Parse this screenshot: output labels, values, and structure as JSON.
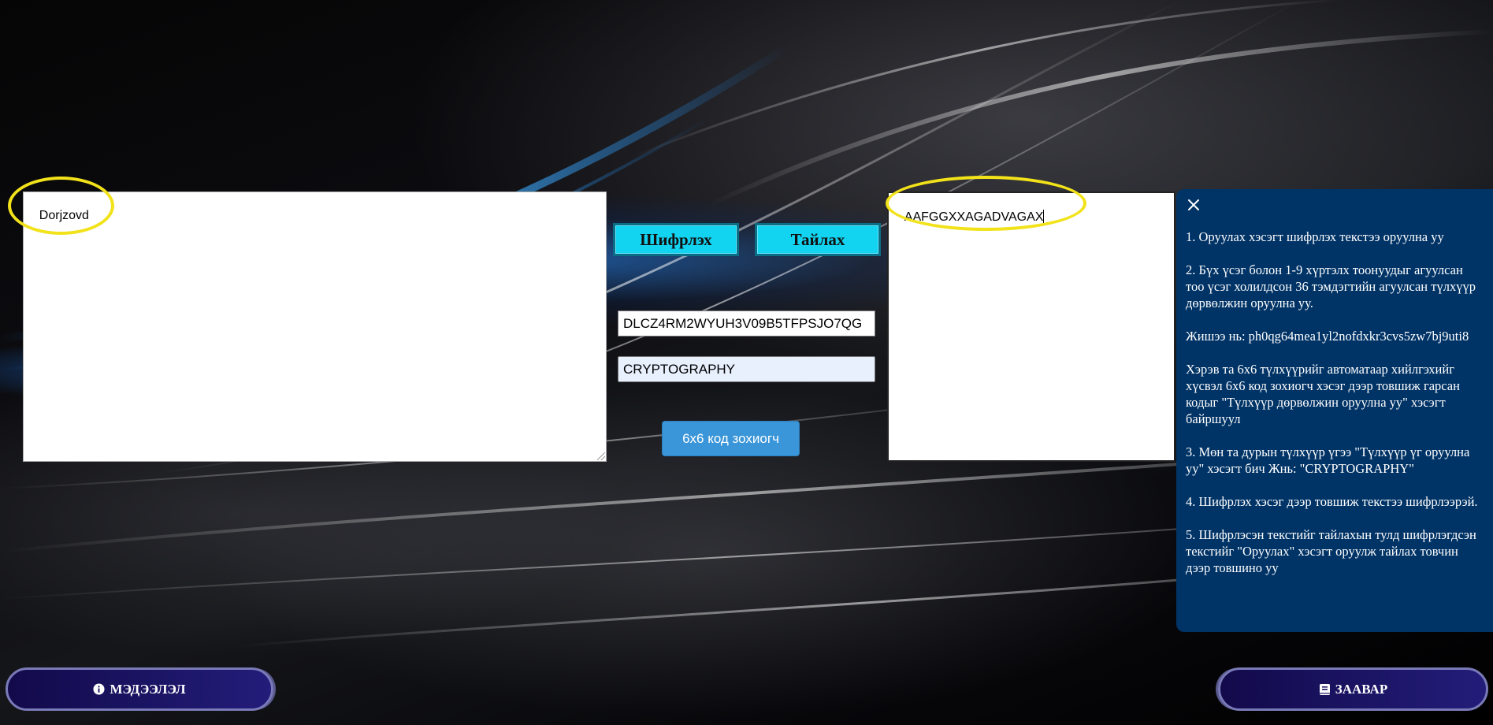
{
  "input": {
    "text": "Dorjzovd"
  },
  "output": {
    "text": "AAFGGXXAGADVAGAX"
  },
  "actions": {
    "encrypt_label": "Шифрлэх",
    "decrypt_label": "Тайлах"
  },
  "fields": {
    "square_key_value": "DLCZ4RM2WYUH3V09B5TFPSJO7QG",
    "keyword_value": "CRYPTOGRAPHY"
  },
  "generator": {
    "label": "6x6 код зохиогч"
  },
  "instructions": {
    "steps": [
      "1. Оруулах хэсэгт шифрлэх текстээ оруулна уу",
      "2. Бүх үсэг болон 1-9 хүртэлх тоонуудыг агуулсан тоо үсэг холилдсон 36 тэмдэгтийн агуулсан түлхүүр дөрвөлжин оруулна уу.",
      "Жишээ нь: ph0qg64mea1yl2nofdxkr3cvs5zw7bj9uti8",
      "Хэрэв та 6х6 түлхүүрийг автоматаар хийлгэхийг хүсвэл 6х6 код зохиогч хэсэг дээр товшиж гарсан кодыг \"Түлхүүр дөрвөлжин оруулна уу\" хэсэгт байршуул",
      "3. Мөн та дурын түлхүүр үгээ \"Түлхүүр үг оруулна уу\" хэсэгт бич Жнь: \"CRYPTOGRAPHY\"",
      "4. Шифрлэх хэсэг дээр товшиж текстээ шифрлээрэй.",
      "5. Шифрлэсэн текстийг тайлахын тулд шифрлэгдсэн текстийг \"Оруулах\" хэсэгт оруулж тайлах товчин дээр товшино уу"
    ]
  },
  "footer": {
    "info_label": "МЭДЭЭЛЭЛ",
    "guide_label": "ЗААВАР"
  },
  "colors": {
    "accent_cyan": "#12d3f0",
    "generator_blue": "#3a96d8",
    "panel_navy": "#003366",
    "highlight_yellow": "#f2e21a"
  },
  "icons": {
    "close": "close-icon",
    "info": "info-circle-icon",
    "book": "book-icon"
  }
}
